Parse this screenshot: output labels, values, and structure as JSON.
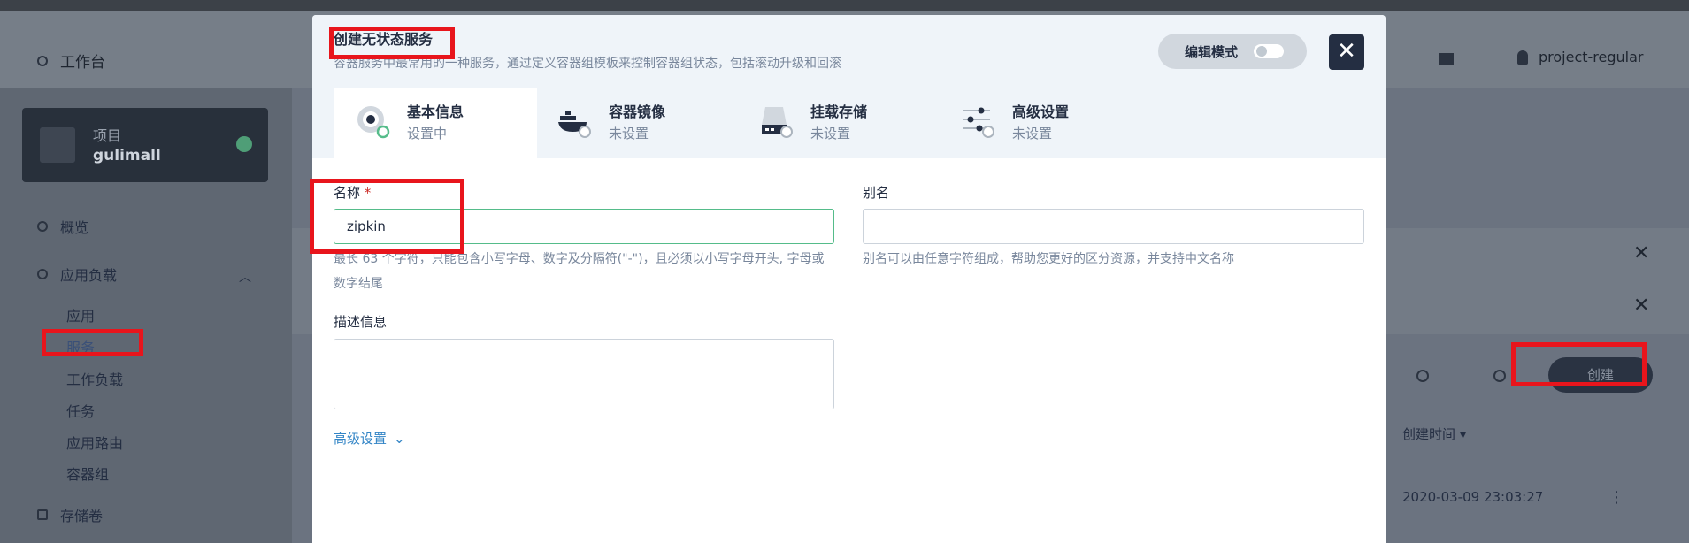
{
  "background": {
    "workbench_label": "工作台",
    "user_label": "project-regular",
    "project_card": {
      "kind_label": "项目",
      "name": "gulimall"
    },
    "nav": {
      "overview": "概览",
      "workloads_group": "应用负载",
      "sub_items": [
        "应用",
        "服务",
        "工作负载",
        "任务",
        "应用路由",
        "容器组"
      ],
      "storage": "存储卷"
    },
    "create_button_label": "创建",
    "table_header_created": "创建时间",
    "table_row_created": "2020-03-09 23:03:27"
  },
  "modal": {
    "title": "创建无状态服务",
    "description": "容器服务中最常用的一种服务，通过定义容器组模板来控制容器组状态，包括滚动升级和回滚",
    "edit_mode_label": "编辑模式",
    "close_icon": "close-icon",
    "tabs": [
      {
        "label": "基本信息",
        "status": "设置中",
        "icon": "info-disc-icon"
      },
      {
        "label": "容器镜像",
        "status": "未设置",
        "icon": "docker-whale-icon"
      },
      {
        "label": "挂载存储",
        "status": "未设置",
        "icon": "storage-disk-icon"
      },
      {
        "label": "高级设置",
        "status": "未设置",
        "icon": "sliders-icon"
      }
    ],
    "form": {
      "name_label": "名称",
      "name_required_mark": "*",
      "name_value": "zipkin",
      "name_hint": "最长 63 个字符，只能包含小写字母、数字及分隔符(\"-\")，且必须以小写字母开头, 字母或数字结尾",
      "alias_label": "别名",
      "alias_value": "",
      "alias_hint": "别名可以由任意字符组成，帮助您更好的区分资源，并支持中文名称",
      "desc_label": "描述信息",
      "desc_value": "",
      "advanced_link": "高级设置"
    }
  },
  "colors": {
    "accent_green": "#55bc8a",
    "dark": "#242e42",
    "link_blue": "#3385c6",
    "annotation_red": "#e8151c"
  }
}
